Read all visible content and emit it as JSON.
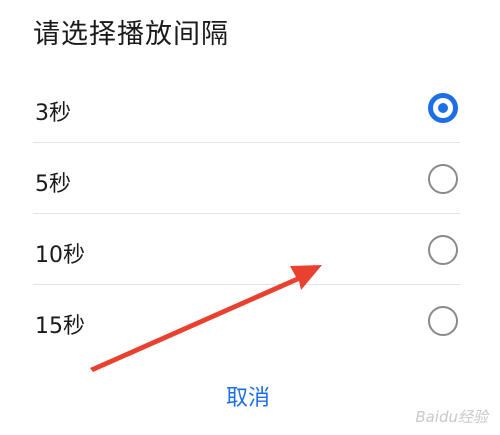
{
  "dialog": {
    "title": "请选择播放间隔",
    "options": [
      {
        "label": "3秒",
        "selected": true
      },
      {
        "label": "5秒",
        "selected": false
      },
      {
        "label": "10秒",
        "selected": false
      },
      {
        "label": "15秒",
        "selected": false
      }
    ],
    "cancel_label": "取消"
  },
  "annotation": {
    "icon": "red-arrow-icon",
    "color": "#e8412f"
  },
  "watermark": {
    "text": "Baidu经验"
  },
  "colors": {
    "accent": "#1e6fe6",
    "text": "#1a1a1a",
    "radio_border": "#8a8a8a"
  }
}
